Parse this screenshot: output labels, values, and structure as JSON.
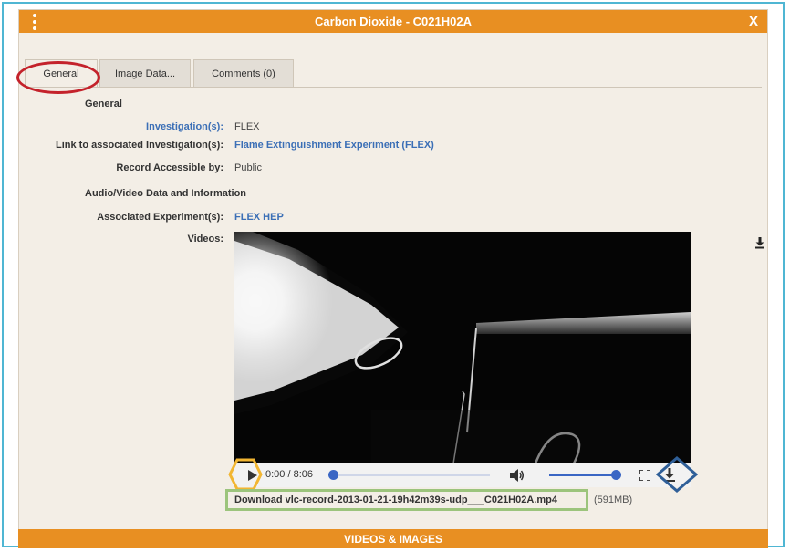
{
  "window": {
    "title": "Carbon Dioxide - C021H02A",
    "close_label": "X"
  },
  "tabs": [
    {
      "label": "General",
      "active": true
    },
    {
      "label": "Image Data...",
      "active": false
    },
    {
      "label": "Comments (0)",
      "active": false
    }
  ],
  "general": {
    "section_title": "General",
    "investigations_label": "Investigation(s):",
    "investigations_value": "FLEX",
    "link_label": "Link to associated Investigation(s):",
    "link_value": "Flame Extinguishment Experiment (FLEX)",
    "access_label": "Record Accessible by:",
    "access_value": "Public"
  },
  "av": {
    "section_title": "Audio/Video Data and Information",
    "experiments_label": "Associated Experiment(s):",
    "experiments_value": "FLEX HEP",
    "videos_label": "Videos:"
  },
  "player": {
    "time": "0:00 / 8:06",
    "progress_fraction": 0.0,
    "volume_fraction": 1.0
  },
  "download": {
    "link_text": "Download vlc-record-2013-01-21-19h42m39s-udp___C021H02A.mp4",
    "size": "(591MB)"
  },
  "footer": {
    "label": "VIDEOS & IMAGES"
  },
  "colors": {
    "titlebar": "#e88f22",
    "link": "#3b6fb6",
    "highlight_red": "#c4222b",
    "highlight_yellow": "#f2b632",
    "highlight_blue": "#2f5f98",
    "highlight_green": "#9cc47c"
  },
  "icons": {
    "menu": "vertical-dots-icon",
    "close": "close-icon",
    "play": "play-icon",
    "volume": "volume-icon",
    "fullscreen": "fullscreen-icon",
    "download": "download-icon"
  }
}
